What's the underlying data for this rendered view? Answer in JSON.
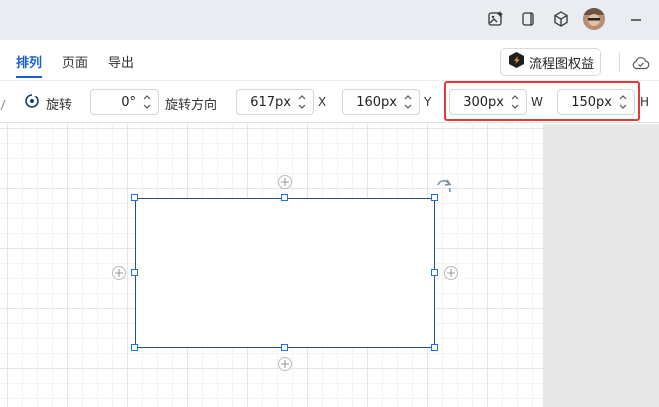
{
  "menubar": {
    "tabs": [
      {
        "label": "排列",
        "active": true
      },
      {
        "label": "页面",
        "active": false
      },
      {
        "label": "导出",
        "active": false
      }
    ],
    "benefit_label": "流程图权益"
  },
  "toolbar": {
    "rotate_label": "旋转",
    "rotation_value": "0°",
    "rotate_direction_label": "旋转方向",
    "x_value": "617px",
    "x_unit": "X",
    "y_value": "160px",
    "y_unit": "Y",
    "w_value": "300px",
    "w_unit": "W",
    "h_value": "150px",
    "h_unit": "H"
  },
  "colors": {
    "accent": "#1a5fcf",
    "highlight": "#e53935",
    "shape_border": "#2c4f7c",
    "handle": "#1a73e8"
  }
}
